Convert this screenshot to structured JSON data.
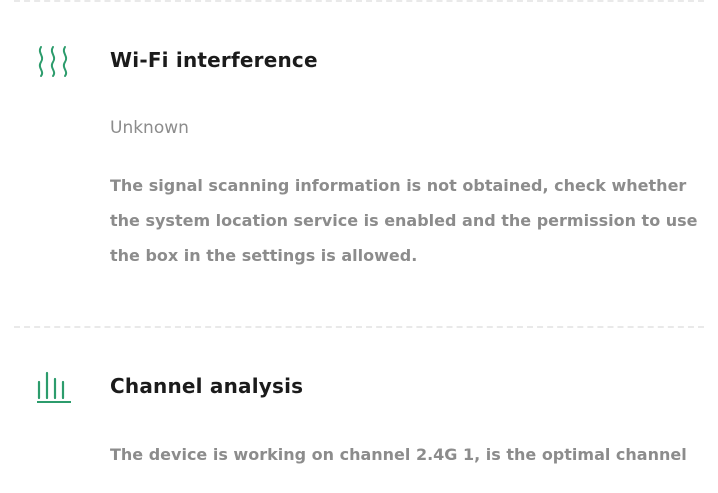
{
  "colors": {
    "accent": "#2c9c6c",
    "title": "#1b1b1b",
    "body": "#8c8c8c",
    "divider": "#e9e9e9"
  },
  "sections": [
    {
      "icon": "wifi-interference-icon",
      "title": "Wi-Fi interference",
      "status": "Unknown",
      "description": "The signal scanning information is not obtained, check whether the system location service is enabled and the permission to use the box in the settings is allowed."
    },
    {
      "icon": "channel-analysis-icon",
      "title": "Channel analysis",
      "description": "The device is working on channel 2.4G 1, is the optimal channel"
    }
  ]
}
